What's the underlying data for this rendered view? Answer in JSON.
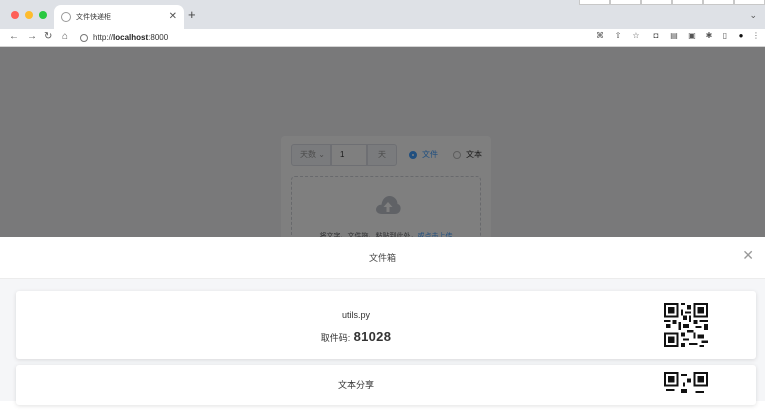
{
  "browser": {
    "tab_title": "文件快递柜",
    "url_prefix": "http://",
    "url_host": "localhost",
    "url_port": ":8000"
  },
  "upload_form": {
    "expire_type": "天数",
    "expire_value": "1",
    "expire_unit": "天",
    "radio_file": "文件",
    "radio_text": "文本",
    "selected_mode": "文件",
    "dropzone_text": "将文字、文件拖、粘贴到此处，",
    "dropzone_link": "或点击上传"
  },
  "drawer": {
    "title": "文件箱",
    "items": [
      {
        "name": "utils.py",
        "code_label": "取件码:",
        "code": "81028"
      },
      {
        "name": "文本分享"
      }
    ]
  },
  "colors": {
    "accent": "#409eff",
    "overlay": "rgba(0,0,0,0.5)"
  },
  "icons": {
    "upload": "cloud-upload-icon",
    "close": "close-icon",
    "qr": "qr-code-icon"
  }
}
